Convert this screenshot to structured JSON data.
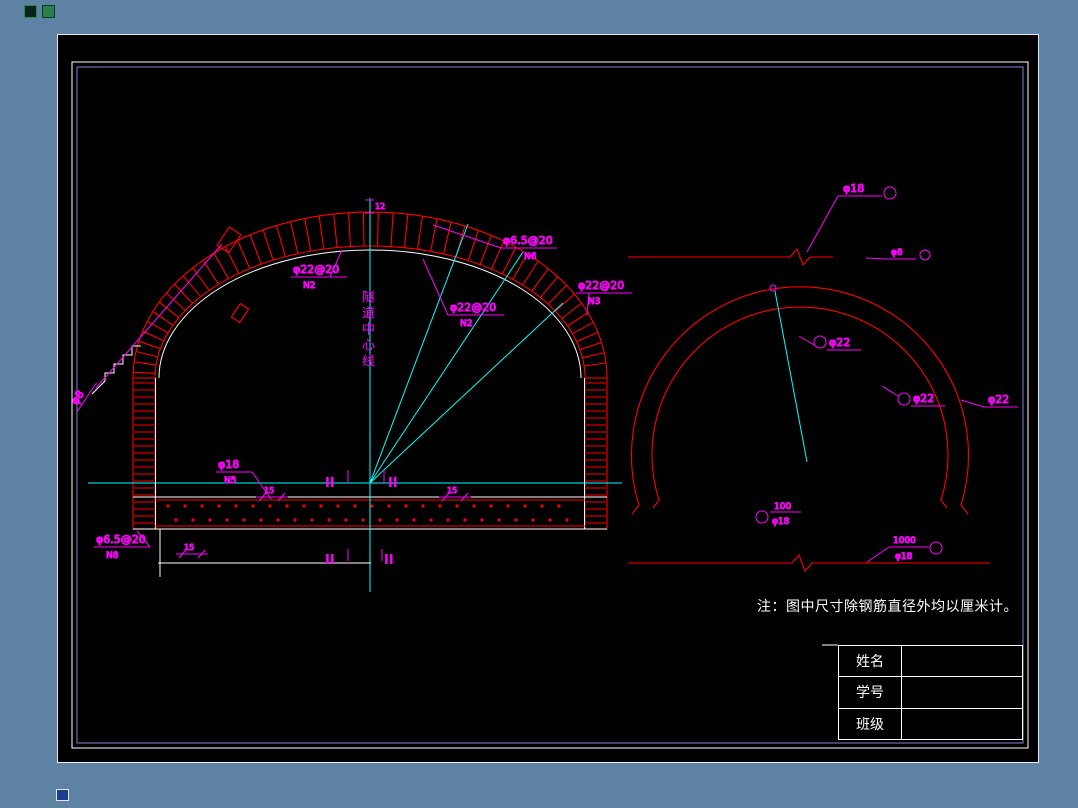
{
  "colors": {
    "background": "#5e82a3",
    "sheet": "#000000",
    "red": "#ff0000",
    "cyan": "#00ffff",
    "magenta": "#ff00ff",
    "white": "#ffffff",
    "frame_blue": "#8080dd"
  },
  "icons": {
    "top_left": [
      "app-icon-dark-green",
      "app-icon-green"
    ],
    "bottom_left": "system-corner-icon"
  },
  "left_drawing": {
    "centerline_label": "隧道中心线",
    "section_label": "II",
    "callouts": [
      {
        "label": "φ6.5@20",
        "mark": "N6"
      },
      {
        "label": "φ22@20",
        "mark": "N2"
      },
      {
        "label": "φ22@20",
        "mark": "N2"
      },
      {
        "label": "φ22@20",
        "mark": "N3"
      },
      {
        "label": "φ18",
        "mark": "N5"
      },
      {
        "label": "φ6.5@20",
        "mark": "N8"
      },
      {
        "label": "φ8",
        "mark": ""
      }
    ],
    "dims": {
      "crown": "12",
      "slab_left": "15",
      "slab_right": "15",
      "footing": "15"
    }
  },
  "right_drawing": {
    "callouts": {
      "top": "φ18",
      "stirrup": "φ8",
      "arc1": "φ22",
      "arc2": "φ22",
      "arc3": "φ22",
      "left_len": "100",
      "left_dia": "φ18",
      "bottom_len": "1000",
      "bottom_dia": "φ18"
    }
  },
  "note": "注：图中尺寸除钢筋直径外均以厘米计。",
  "info_table": {
    "rows": [
      {
        "label": "姓名",
        "value": ""
      },
      {
        "label": "学号",
        "value": ""
      },
      {
        "label": "班级",
        "value": ""
      }
    ]
  }
}
